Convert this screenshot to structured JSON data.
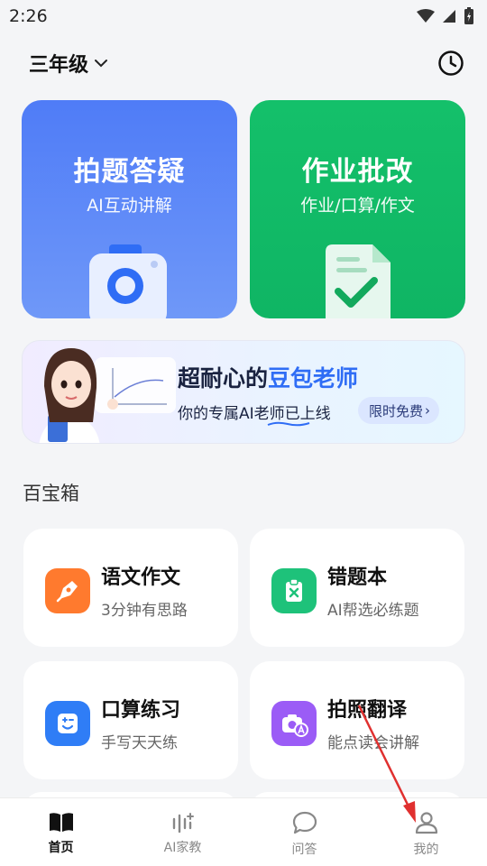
{
  "status_bar": {
    "time": "2:26"
  },
  "header": {
    "grade": "三年级"
  },
  "feature_cards": [
    {
      "title": "拍题答疑",
      "subtitle": "AI互动讲解",
      "color": "#4f7cf7"
    },
    {
      "title": "作业批改",
      "subtitle": "作业/口算/作文",
      "color": "#14c06a"
    }
  ],
  "banner": {
    "headline_prefix": "超耐心的",
    "headline_highlight": "豆包老师",
    "tagline": "你的专属AI老师已上线",
    "pill": "限时免费",
    "pill_arrow": "›"
  },
  "section": {
    "title": "百宝箱"
  },
  "tools": [
    {
      "name": "语文作文",
      "desc": "3分钟有思路",
      "icon": "pen-nib-icon",
      "color": "#ff7a2e"
    },
    {
      "name": "错题本",
      "desc": "AI帮选必练题",
      "icon": "clipboard-x-icon",
      "color": "#1ec27a"
    },
    {
      "name": "口算练习",
      "desc": "手写天天练",
      "icon": "calc-face-icon",
      "color": "#2f7df6"
    },
    {
      "name": "拍照翻译",
      "desc": "能点读会讲解",
      "icon": "camera-translate-icon",
      "color": "#9b5cf6"
    }
  ],
  "tabbar": {
    "items": [
      {
        "label": "首页",
        "icon": "book-icon",
        "active": true
      },
      {
        "label": "AI家教",
        "icon": "ai-tutor-icon",
        "active": false
      },
      {
        "label": "问答",
        "icon": "chat-bubble-icon",
        "active": false
      },
      {
        "label": "我的",
        "icon": "person-icon",
        "active": false
      }
    ]
  },
  "annotation": {
    "arrow_color": "#e0302f"
  }
}
